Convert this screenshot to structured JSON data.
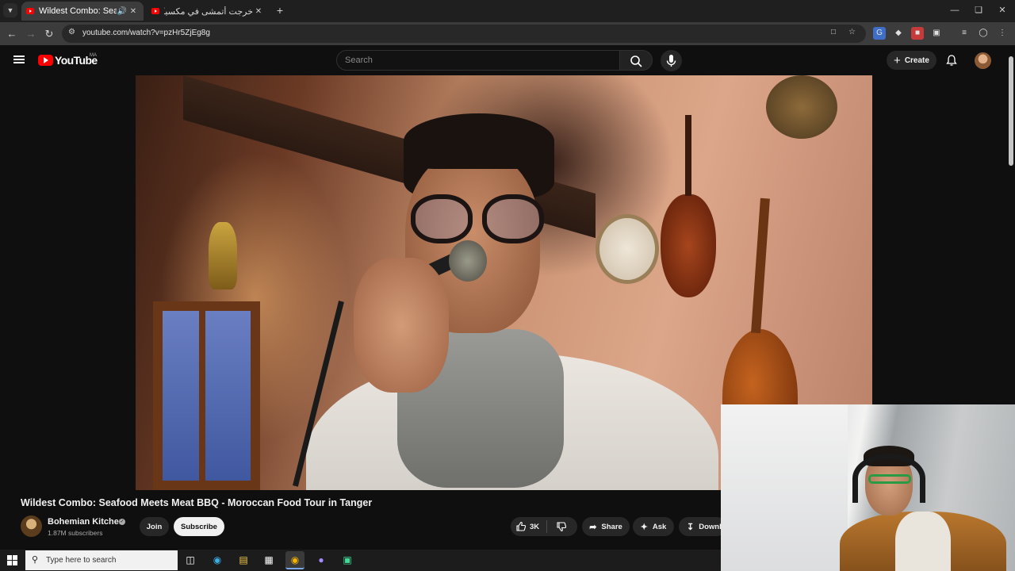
{
  "browser": {
    "tabs": [
      {
        "title": "Wildest Combo: Seafood M",
        "active": true
      },
      {
        "title": "خرجت أتمشى في مكسيكو... وتعرفت",
        "active": false
      }
    ],
    "url": "youtube.com/watch?v=pzHr5ZjEg8g"
  },
  "youtube": {
    "logo_text": "YouTube",
    "region": "MA",
    "search_placeholder": "Search",
    "create_label": "Create"
  },
  "video": {
    "title": "Wildest Combo: Seafood Meets Meat BBQ - Moroccan Food Tour in Tanger",
    "channel_name": "Bohemian Kitchen",
    "subscribers": "1.87M subscribers",
    "join_label": "Join",
    "subscribe_label": "Subscribe",
    "likes": "3K",
    "share_label": "Share",
    "ask_label": "Ask",
    "download_label": "Download"
  },
  "taskbar": {
    "search_placeholder": "Type here to search"
  },
  "colors": {
    "yt_red": "#ff0000",
    "bg": "#0f0f0f",
    "pill": "#272727"
  }
}
